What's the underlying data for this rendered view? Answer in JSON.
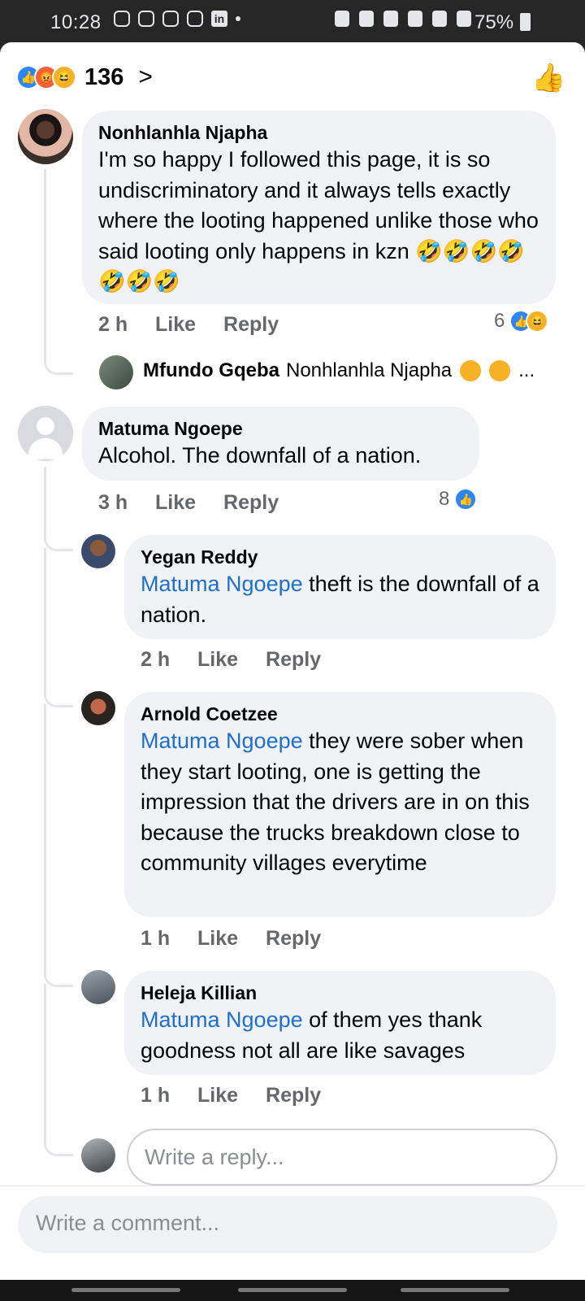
{
  "status_bar": {
    "time": "10:28",
    "battery": "75%",
    "linkedin_label": "in"
  },
  "reactions_header": {
    "count": "136",
    "chevron": ">",
    "reactions": [
      "like",
      "angry",
      "haha"
    ]
  },
  "comments": [
    {
      "author": "Nonhlanhla Njapha",
      "text": "I'm so happy I followed this page, it is so undiscriminatory and it always tells exactly where the looting happened unlike those who said looting only happens in kzn 🤣🤣🤣🤣🤣🤣🤣",
      "time": "2 h",
      "like_label": "Like",
      "reply_label": "Reply",
      "reaction_count": "6",
      "collapsed_reply": {
        "author": "Mfundo Gqeba",
        "mention": "Nonhlanhla Njapha",
        "ellipsis": "..."
      }
    },
    {
      "author": "Matuma Ngoepe",
      "text": "Alcohol. The downfall of a nation.",
      "time": "3 h",
      "like_label": "Like",
      "reply_label": "Reply",
      "reaction_count": "8",
      "replies": [
        {
          "author": "Yegan Reddy",
          "mention": "Matuma Ngoepe",
          "text": " theft is the downfall of a nation.",
          "time": "2 h",
          "like_label": "Like",
          "reply_label": "Reply"
        },
        {
          "author": "Arnold Coetzee",
          "mention": "Matuma Ngoepe",
          "text": " they were sober when they start looting, one is getting the impression that the drivers are in on this because the trucks breakdown close to community villages everytime",
          "time": "1 h",
          "like_label": "Like",
          "reply_label": "Reply"
        },
        {
          "author": "Heleja Killian",
          "mention": "Matuma Ngoepe",
          "text": " of them yes thank goodness not all are like savages",
          "time": "1 h",
          "like_label": "Like",
          "reply_label": "Reply"
        }
      ]
    }
  ],
  "reply_input": {
    "placeholder": "Write a reply..."
  },
  "comment_input": {
    "placeholder": "Write a comment..."
  },
  "colors": {
    "mention": "#1f6fc9",
    "like_reaction": "#2d86ff",
    "angry_reaction": "#f26138",
    "haha_reaction": "#f7b125"
  }
}
